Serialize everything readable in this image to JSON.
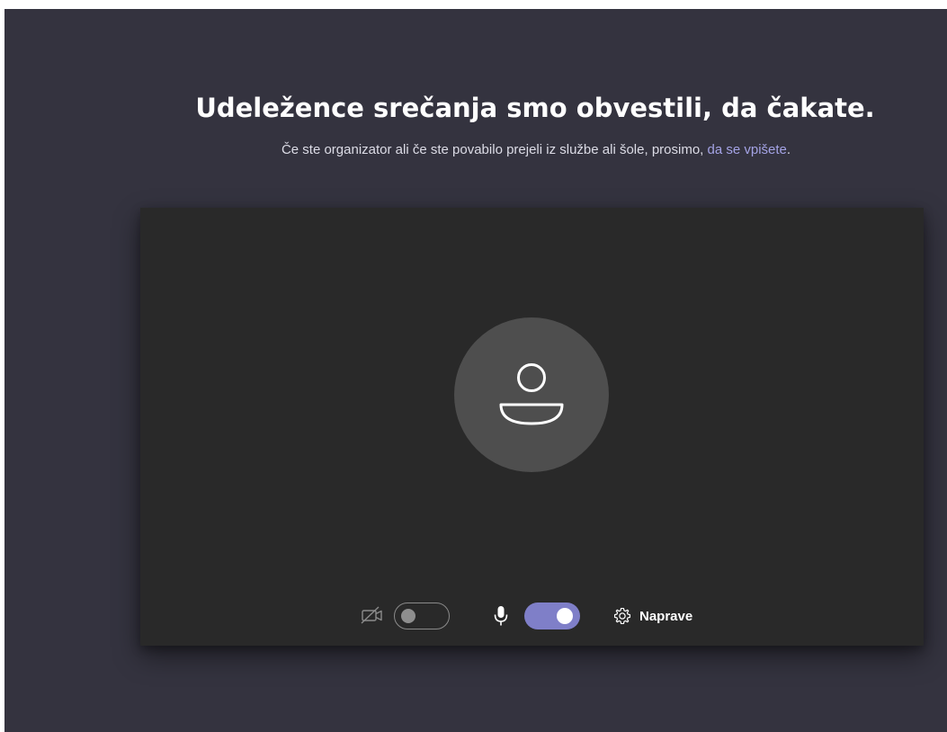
{
  "lobby": {
    "title": "Udeležence srečanja smo obvestili, da čakate.",
    "subtitle_text": "Če ste organizator ali če ste povabilo prejeli iz službe ali šole, prosimo, ",
    "signin_link": "da se vpišete",
    "subtitle_end": "."
  },
  "preview": {
    "avatar_icon": "person-icon",
    "camera": {
      "icon": "camera-off-icon",
      "enabled": false
    },
    "microphone": {
      "icon": "microphone-icon",
      "enabled": true
    },
    "devices": {
      "icon": "gear-icon",
      "label": "Naprave"
    }
  },
  "colors": {
    "background": "#34333f",
    "preview_bg": "#292929",
    "accent": "#7f7fc8",
    "link": "#a4a3e5"
  }
}
